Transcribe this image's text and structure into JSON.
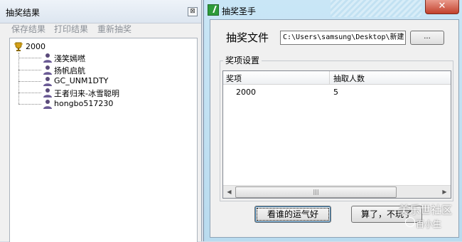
{
  "left_window": {
    "title": "抽奖结果",
    "close_glyph": "⊠",
    "menu": [
      "保存结果",
      "打印结果",
      "重新抽奖"
    ],
    "tree": {
      "root_label": "2000",
      "root_icon": "trophy-icon",
      "children": [
        "淺笑嫣嘫",
        "扬帆启航",
        "GC_UNM1DTY",
        "王者归来-冰雪聪明",
        "hongbo517230"
      ],
      "child_icon": "user-icon"
    }
  },
  "right_window": {
    "title": "抽奖圣手",
    "close_glyph": "✕",
    "file_label": "抽奖文件",
    "file_path": "C:\\Users\\samsung\\Desktop\\新建",
    "browse_label": "...",
    "group_title": "奖项设置",
    "table": {
      "columns": [
        "奖项",
        "抽取人数"
      ],
      "rows": [
        [
          "2000",
          "5"
        ]
      ]
    },
    "scroll_thumb_glyph": "|||",
    "buttons": {
      "lucky": "看谁的运气好",
      "quit": "算了，不玩了"
    }
  },
  "watermark": {
    "line1": "美乐世社区",
    "line2": "百小生"
  }
}
